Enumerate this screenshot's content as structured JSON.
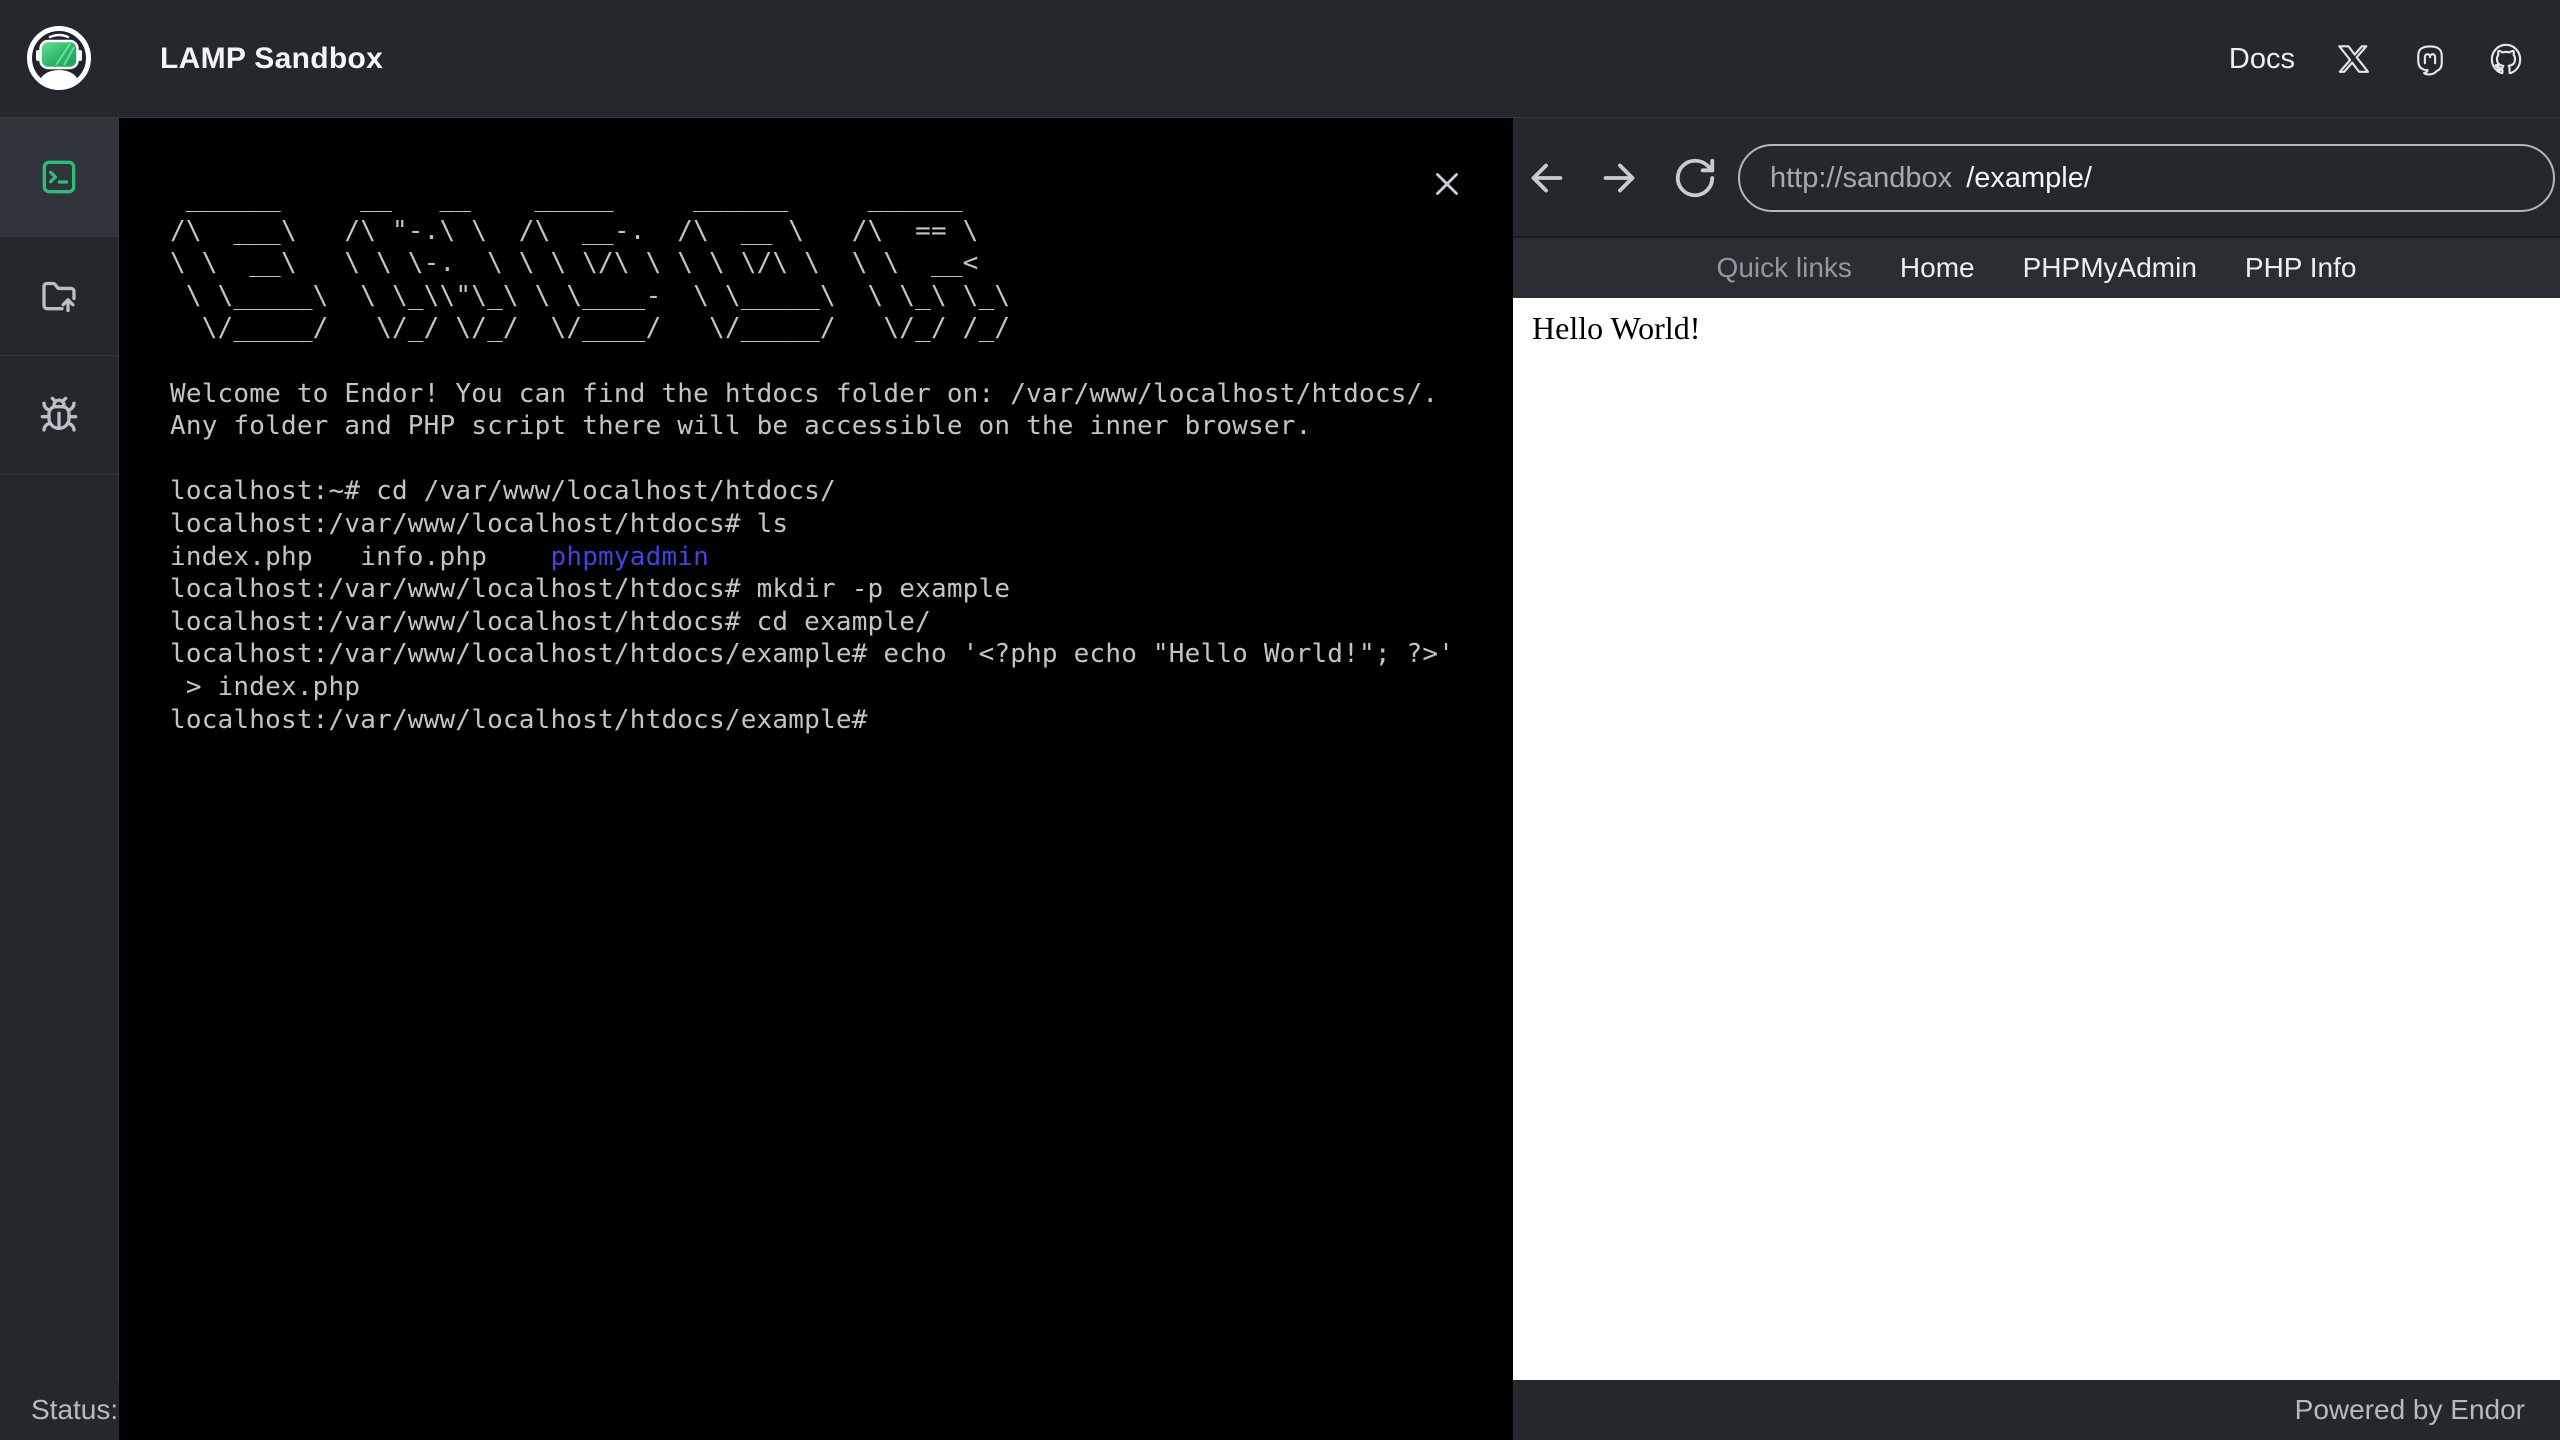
{
  "app": {
    "title": "LAMP Sandbox"
  },
  "header": {
    "docs_label": "Docs",
    "icons": [
      "x-logo",
      "mastodon-logo",
      "github-logo"
    ]
  },
  "sidebar": {
    "items": [
      {
        "icon": "terminal",
        "active": true
      },
      {
        "icon": "folder-upload",
        "active": false
      },
      {
        "icon": "bug",
        "active": false
      }
    ]
  },
  "terminal": {
    "ascii_art": [
      " ______     __   __    _____     ______     ______",
      "/\\  ___\\   /\\ \"-.\\ \\  /\\  __-.  /\\  __ \\   /\\  == \\",
      "\\ \\  __\\   \\ \\ \\-.  \\ \\ \\ \\/\\ \\ \\ \\ \\/\\ \\  \\ \\  __<",
      " \\ \\_____\\  \\ \\_\\\\\"\\_\\ \\ \\____-  \\ \\_____\\  \\ \\_\\ \\_\\",
      "  \\/_____/   \\/_/ \\/_/  \\/____/   \\/_____/   \\/_/ /_/"
    ],
    "lines": [
      [
        {
          "t": ""
        }
      ],
      [
        {
          "t": "Welcome to Endor! You can find the htdocs folder on: /var/www/localhost/htdocs/."
        }
      ],
      [
        {
          "t": "Any folder and PHP script there will be accessible on the inner browser."
        }
      ],
      [
        {
          "t": ""
        }
      ],
      [
        {
          "t": "localhost:~# cd /var/www/localhost/htdocs/"
        }
      ],
      [
        {
          "t": "localhost:/var/www/localhost/htdocs# ls"
        }
      ],
      [
        {
          "t": "index.php   info.php    "
        },
        {
          "t": "phpmyadmin",
          "s": "dir"
        }
      ],
      [
        {
          "t": "localhost:/var/www/localhost/htdocs# mkdir -p example"
        }
      ],
      [
        {
          "t": "localhost:/var/www/localhost/htdocs# cd example/"
        }
      ],
      [
        {
          "t": "localhost:/var/www/localhost/htdocs/example# echo '<?php echo \"Hello World!\"; ?>'"
        }
      ],
      [
        {
          "t": " > index.php"
        }
      ],
      [
        {
          "t": "localhost:/var/www/localhost/htdocs/example#"
        }
      ]
    ]
  },
  "browser": {
    "url_bar": {
      "prefix": "http://sandbox",
      "value": "/example/"
    },
    "quick_links": {
      "label": "Quick links",
      "links": [
        "Home",
        "PHPMyAdmin",
        "PHP Info"
      ]
    },
    "content": {
      "text": "Hello World!"
    }
  },
  "status_bar": {
    "left": "Status:",
    "right": "Powered by Endor"
  },
  "colors": {
    "chrome_dark": "#24282c",
    "quickbar_dark": "#2a2e33",
    "terminal_bg": "#000000",
    "accent_green": "#2ebe7b",
    "terminal_dir_blue": "#4343df",
    "content_bg": "#ffffff"
  }
}
